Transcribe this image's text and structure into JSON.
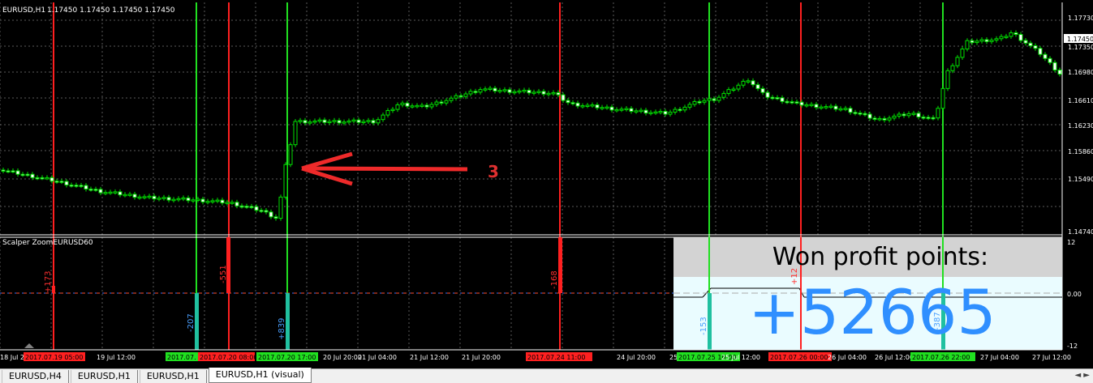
{
  "header": {
    "title": "EURUSD,H1",
    "ohlc": "1.17450 1.17450 1.17450 1.17450"
  },
  "indicator_name": "Scalper ZoomEURUSD60",
  "price_axis": {
    "ticks": [
      "1.17730",
      "1.17350",
      "1.16980",
      "1.16610",
      "1.16230",
      "1.15860",
      "1.15490",
      "1.14740"
    ],
    "current": "1.17450"
  },
  "sub_axis": {
    "ticks": [
      "12",
      "0.00",
      "-12"
    ]
  },
  "annotation": {
    "number": "3"
  },
  "signals": {
    "red": [
      "+173",
      "-551",
      "-168",
      "+12"
    ],
    "blue": [
      "-207",
      "+839",
      "-153",
      "-387"
    ]
  },
  "profit_panel": {
    "title": "Won profit points:",
    "value": "+52665"
  },
  "time_axis": {
    "labels": [
      "18 Jul 2",
      "19 Jul 12:00",
      "20 Jul 20:00",
      "21 Jul 04:00",
      "21 Jul 12:00",
      "21 Jul 20:00",
      "24 Jul 20:00",
      "25",
      "25 Jul 12:00",
      "26 Jul 04:00",
      "26 Jul 12:00",
      "26 Jul 20:00",
      "27 Jul 04:00",
      "27 Jul 12:00"
    ],
    "red_markers": [
      "2017.07.19 05:00",
      "2017.07.20 08:00",
      "2017.07.24 11:00",
      "2017.07.26 00:00"
    ],
    "green_markers": [
      "2017.07.",
      "2017.07.20 17:00",
      "2017.07.25 10:00",
      "2017.07.26 22:00"
    ]
  },
  "tabs": [
    {
      "label": "EURUSD,H4",
      "active": false
    },
    {
      "label": "EURUSD,H1",
      "active": false
    },
    {
      "label": "EURUSD,H1",
      "active": false
    },
    {
      "label": "EURUSD,H1 (visual)",
      "active": true
    }
  ],
  "colors": {
    "up": "#00e000",
    "down": "#00e000",
    "red_line": "#ff2020",
    "green_line": "#20e020",
    "blue_text": "#4aa0ff",
    "panel_bg": "#eafcff"
  }
}
